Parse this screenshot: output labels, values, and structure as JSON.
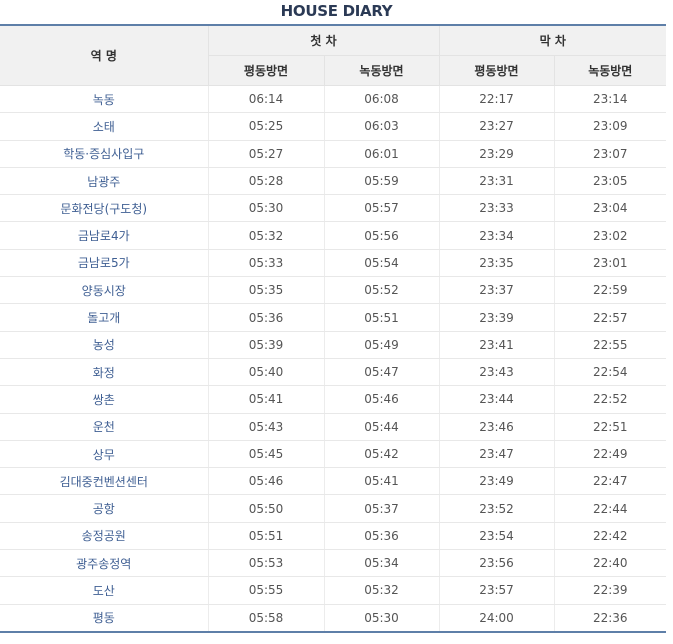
{
  "title": "HOUSE DIARY",
  "header": {
    "station_col": "역  명",
    "first_train": "첫 차",
    "last_train": "막 차",
    "dir_pyeongdong": "평동방면",
    "dir_nokdong": "녹동방면"
  },
  "rows": [
    {
      "station": "녹동",
      "first_pd": "06:14",
      "first_nd": "06:08",
      "last_pd": "22:17",
      "last_nd": "23:14"
    },
    {
      "station": "소태",
      "first_pd": "05:25",
      "first_nd": "06:03",
      "last_pd": "23:27",
      "last_nd": "23:09"
    },
    {
      "station": "학동·증심사입구",
      "first_pd": "05:27",
      "first_nd": "06:01",
      "last_pd": "23:29",
      "last_nd": "23:07"
    },
    {
      "station": "남광주",
      "first_pd": "05:28",
      "first_nd": "05:59",
      "last_pd": "23:31",
      "last_nd": "23:05"
    },
    {
      "station": "문화전당(구도청)",
      "first_pd": "05:30",
      "first_nd": "05:57",
      "last_pd": "23:33",
      "last_nd": "23:04"
    },
    {
      "station": "금남로4가",
      "first_pd": "05:32",
      "first_nd": "05:56",
      "last_pd": "23:34",
      "last_nd": "23:02"
    },
    {
      "station": "금남로5가",
      "first_pd": "05:33",
      "first_nd": "05:54",
      "last_pd": "23:35",
      "last_nd": "23:01"
    },
    {
      "station": "양동시장",
      "first_pd": "05:35",
      "first_nd": "05:52",
      "last_pd": "23:37",
      "last_nd": "22:59"
    },
    {
      "station": "돌고개",
      "first_pd": "05:36",
      "first_nd": "05:51",
      "last_pd": "23:39",
      "last_nd": "22:57"
    },
    {
      "station": "농성",
      "first_pd": "05:39",
      "first_nd": "05:49",
      "last_pd": "23:41",
      "last_nd": "22:55"
    },
    {
      "station": "화정",
      "first_pd": "05:40",
      "first_nd": "05:47",
      "last_pd": "23:43",
      "last_nd": "22:54"
    },
    {
      "station": "쌍촌",
      "first_pd": "05:41",
      "first_nd": "05:46",
      "last_pd": "23:44",
      "last_nd": "22:52"
    },
    {
      "station": "운천",
      "first_pd": "05:43",
      "first_nd": "05:44",
      "last_pd": "23:46",
      "last_nd": "22:51"
    },
    {
      "station": "상무",
      "first_pd": "05:45",
      "first_nd": "05:42",
      "last_pd": "23:47",
      "last_nd": "22:49"
    },
    {
      "station": "김대중컨벤션센터",
      "first_pd": "05:46",
      "first_nd": "05:41",
      "last_pd": "23:49",
      "last_nd": "22:47"
    },
    {
      "station": "공항",
      "first_pd": "05:50",
      "first_nd": "05:37",
      "last_pd": "23:52",
      "last_nd": "22:44"
    },
    {
      "station": "송정공원",
      "first_pd": "05:51",
      "first_nd": "05:36",
      "last_pd": "23:54",
      "last_nd": "22:42"
    },
    {
      "station": "광주송정역",
      "first_pd": "05:53",
      "first_nd": "05:34",
      "last_pd": "23:56",
      "last_nd": "22:40"
    },
    {
      "station": "도산",
      "first_pd": "05:55",
      "first_nd": "05:32",
      "last_pd": "23:57",
      "last_nd": "22:39"
    },
    {
      "station": "평동",
      "first_pd": "05:58",
      "first_nd": "05:30",
      "last_pd": "24:00",
      "last_nd": "22:36"
    }
  ]
}
